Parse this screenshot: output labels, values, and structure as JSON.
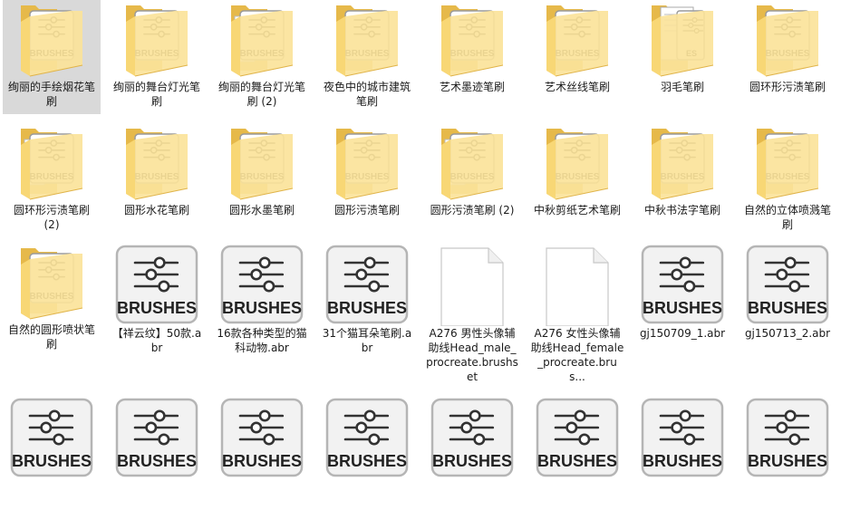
{
  "rows": [
    [
      {
        "type": "folder",
        "label": "绚丽的手绘烟花笔刷",
        "selected": true
      },
      {
        "type": "folder",
        "label": "绚丽的舞台灯光笔刷"
      },
      {
        "type": "folder-docs",
        "label": "绚丽的舞台灯光笔刷 (2)"
      },
      {
        "type": "folder",
        "label": "夜色中的城市建筑笔刷"
      },
      {
        "type": "folder",
        "label": "艺术墨迹笔刷"
      },
      {
        "type": "folder",
        "label": "艺术丝线笔刷"
      },
      {
        "type": "folder-paper",
        "label": "羽毛笔刷"
      },
      {
        "type": "folder",
        "label": "圆环形污渍笔刷"
      }
    ],
    [
      {
        "type": "folder-docs",
        "label": "圆环形污渍笔刷 (2)"
      },
      {
        "type": "folder",
        "label": "圆形水花笔刷"
      },
      {
        "type": "folder",
        "label": "圆形水墨笔刷"
      },
      {
        "type": "folder",
        "label": "圆形污渍笔刷"
      },
      {
        "type": "folder-docs",
        "label": "圆形污渍笔刷 (2)"
      },
      {
        "type": "folder",
        "label": "中秋剪纸艺术笔刷"
      },
      {
        "type": "folder",
        "label": "中秋书法字笔刷"
      },
      {
        "type": "folder",
        "label": "自然的立体喷溅笔刷"
      }
    ],
    [
      {
        "type": "folder",
        "label": "自然的圆形喷状笔刷"
      },
      {
        "type": "abr",
        "label": "【祥云纹】50款.abr"
      },
      {
        "type": "abr",
        "label": "16款各种类型的猫科动物.abr"
      },
      {
        "type": "abr",
        "label": "31个猫耳朵笔刷.abr"
      },
      {
        "type": "doc",
        "label": "A276 男性头像辅助线Head_male_procreate.brushset"
      },
      {
        "type": "doc",
        "label": "A276 女性头像辅助线Head_female_procreate.brus..."
      },
      {
        "type": "abr",
        "label": "gj150709_1.abr"
      },
      {
        "type": "abr",
        "label": "gj150713_2.abr"
      }
    ],
    [
      {
        "type": "abr",
        "label": ""
      },
      {
        "type": "abr",
        "label": ""
      },
      {
        "type": "abr",
        "label": ""
      },
      {
        "type": "abr",
        "label": ""
      },
      {
        "type": "abr",
        "label": ""
      },
      {
        "type": "abr",
        "label": ""
      },
      {
        "type": "abr",
        "label": ""
      },
      {
        "type": "abr",
        "label": ""
      }
    ]
  ],
  "icon_text": "BRUSHES",
  "colors": {
    "folder_back": "#e6b94a",
    "folder_front": "#f8d775",
    "folder_front_light": "#fbe39a",
    "selection": "#d9d9d9",
    "badge_border": "#b5b5b5",
    "badge_fill": "#f2f2f2"
  }
}
